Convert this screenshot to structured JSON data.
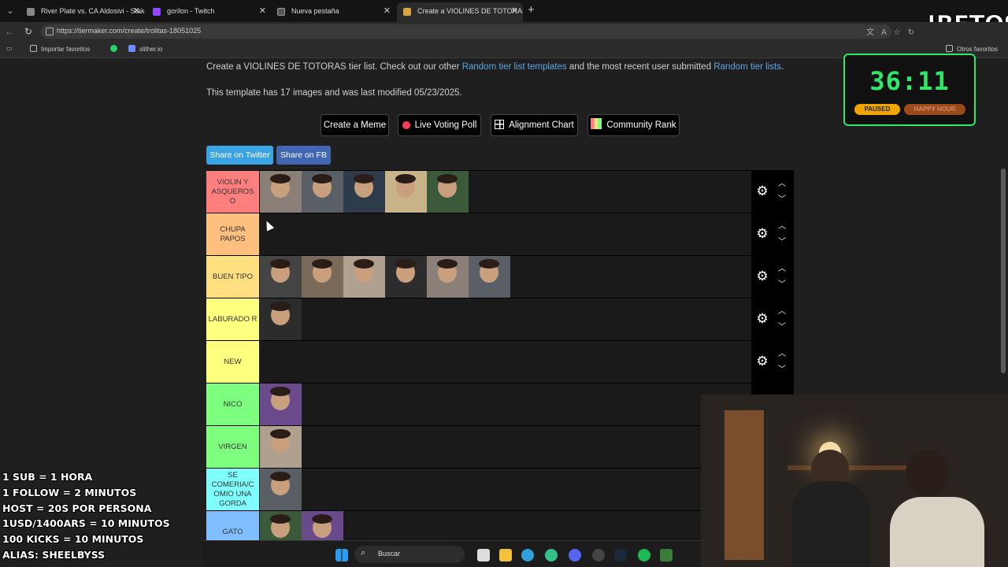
{
  "browser": {
    "tabs": [
      {
        "title": "River Plate vs. CA Aldosivi - Stake.",
        "icon_color": "#888888"
      },
      {
        "title": "gorilon - Twitch",
        "icon_color": "#9146ff"
      },
      {
        "title": "Nueva pestaña",
        "icon_color": "#888888"
      },
      {
        "title": "Create a VIOLINES DE TOTORAS T",
        "icon_color": "#d9a441"
      }
    ],
    "url": "https://tiermaker.com/create/trolitas-18051025",
    "bookmarks": [
      "Importar favoritos",
      "slither.io"
    ],
    "other_bookmarks": "Otros favoritos"
  },
  "stream": {
    "retos_label": "!RETOS",
    "timer": "36:11",
    "paused_label": "PAUSED",
    "happy_hour_label": "HAPPY HOUR",
    "rules": [
      "1 SUB = 1 HORA",
      "1 FOLLOW = 2 MINUTOS",
      "HOST = 20S POR PERSONA",
      "1USD/1400ARS = 10 MINUTOS",
      "100 KICKS = 10 MINUTOS",
      "ALIAS: SHEELBYSS"
    ]
  },
  "page": {
    "intro_prefix": "Create a VIOLINES DE TOTORAS tier list. Check out our other ",
    "intro_link1": "Random tier list templates",
    "intro_mid": " and the most recent user submitted ",
    "intro_link2": "Random tier lists",
    "intro_suffix": ".",
    "template_info": "This template has 17 images and was last modified 05/23/2025.",
    "buttons": {
      "meme": "Create a Meme",
      "poll": "Live Voting Poll",
      "alignment": "Alignment Chart",
      "community": "Community Rank"
    },
    "share_twitter": "Share on Twitter",
    "share_fb": "Share on FB"
  },
  "tiers": [
    {
      "label": "VIOLIN Y ASQUEROS O",
      "color": "#ff7f7f",
      "count": 5
    },
    {
      "label": "CHUPA PAPOS",
      "color": "#ffbf7f",
      "count": 0
    },
    {
      "label": "BUEN TIPO",
      "color": "#ffdf7f",
      "count": 6
    },
    {
      "label": "LABURADO R",
      "color": "#ffff7f",
      "count": 1
    },
    {
      "label": "NEW",
      "color": "#ffff7f",
      "count": 0
    },
    {
      "label": "NICO",
      "color": "#7fff7f",
      "count": 1
    },
    {
      "label": "VIRGEN",
      "color": "#7fff7f",
      "count": 1
    },
    {
      "label": "SE COMERIA/C OMIO UNA GORDA",
      "color": "#7fffff",
      "count": 1
    },
    {
      "label": "GATO",
      "color": "#7fbfff",
      "count": 2
    }
  ],
  "taskbar": {
    "search_label": "Buscar"
  }
}
